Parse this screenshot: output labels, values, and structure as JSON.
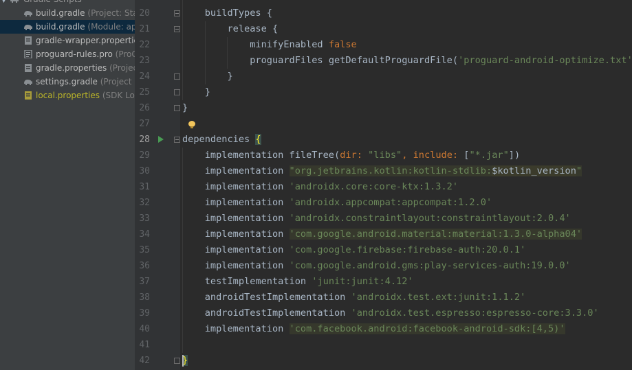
{
  "project_tree": {
    "header": {
      "label": "Gradle Scripts"
    },
    "items": [
      {
        "name": "build.gradle",
        "hint": "(Project: Stagr",
        "icon": "gradle-elephant-icon",
        "selected": false
      },
      {
        "name": "build.gradle",
        "hint": "(Module: app)",
        "icon": "gradle-elephant-icon",
        "selected": true
      },
      {
        "name": "gradle-wrapper.properties",
        "hint": "(",
        "icon": "properties-file-icon",
        "selected": false
      },
      {
        "name": "proguard-rules.pro",
        "hint": "(ProGua",
        "icon": "text-file-icon",
        "selected": false
      },
      {
        "name": "gradle.properties",
        "hint": "(Project P",
        "icon": "properties-file-icon",
        "selected": false
      },
      {
        "name": "settings.gradle",
        "hint": "(Project Set",
        "icon": "gradle-elephant-icon",
        "selected": false
      },
      {
        "name": "local.properties",
        "hint": "(SDK Locat",
        "icon": "properties-file-icon",
        "selected": false,
        "warn": true
      }
    ]
  },
  "editor": {
    "line_numbers": [
      "20",
      "21",
      "22",
      "23",
      "24",
      "25",
      "26",
      "27",
      "28",
      "29",
      "30",
      "31",
      "32",
      "33",
      "34",
      "35",
      "36",
      "37",
      "38",
      "39",
      "40",
      "41",
      "42"
    ],
    "current_line": "28",
    "lines": {
      "l20": {
        "name": "buildTypes",
        "brace": "{"
      },
      "l21": {
        "name": "release",
        "brace": "{"
      },
      "l22": {
        "name": "minifyEnabled",
        "value": "false"
      },
      "l23": {
        "name": "proguardFiles",
        "call": "getDefaultProguardFile(",
        "arg": "'proguard-android-optimize.txt'",
        "rest": "),"
      },
      "l24": {
        "brace": "}"
      },
      "l25": {
        "brace": "}"
      },
      "l26": {
        "brace": "}"
      },
      "l28": {
        "name": "dependencies",
        "brace": "{"
      },
      "l29": {
        "keyword": "implementation",
        "call": "fileTree(",
        "p1": "dir:",
        "v1": "\"libs\"",
        "comma": ",",
        "p2": "include:",
        "open": "[",
        "v2": "\"*.jar\"",
        "close": "])"
      },
      "l30": {
        "keyword": "implementation",
        "str_a": "\"org.jetbrains.kotlin:kotlin-stdlib:",
        "var": "$kotlin_version",
        "str_b": "\""
      },
      "l31": {
        "keyword": "implementation",
        "str": "'androidx.core:core-ktx:1.3.2'"
      },
      "l32": {
        "keyword": "implementation",
        "str": "'androidx.appcompat:appcompat:1.2.0'"
      },
      "l33": {
        "keyword": "implementation",
        "str": "'androidx.constraintlayout:constraintlayout:2.0.4'"
      },
      "l34": {
        "keyword": "implementation",
        "str": "'com.google.android.material:material:1.3.0-alpha04'"
      },
      "l35": {
        "keyword": "implementation",
        "str": "'com.google.firebase:firebase-auth:20.0.1'"
      },
      "l36": {
        "keyword": "implementation",
        "str": "'com.google.android.gms:play-services-auth:19.0.0'"
      },
      "l37": {
        "keyword": "testImplementation",
        "str": "'junit:junit:4.12'"
      },
      "l38": {
        "keyword": "androidTestImplementation",
        "str": "'androidx.test.ext:junit:1.1.2'"
      },
      "l39": {
        "keyword": "androidTestImplementation",
        "str": "'androidx.test.espresso:espresso-core:3.3.0'"
      },
      "l40": {
        "keyword": "implementation",
        "str": "'com.facebook.android:facebook-android-sdk:[4,5)'"
      },
      "l42": {
        "brace": "}"
      }
    }
  },
  "colors": {
    "keyword": "#cc7832",
    "string": "#6a8759",
    "text": "#a9b7c6",
    "editor_bg": "#2b2b2b",
    "gutter_bg": "#313335",
    "tree_bg": "#3c3f41",
    "selection": "#0d293e"
  }
}
